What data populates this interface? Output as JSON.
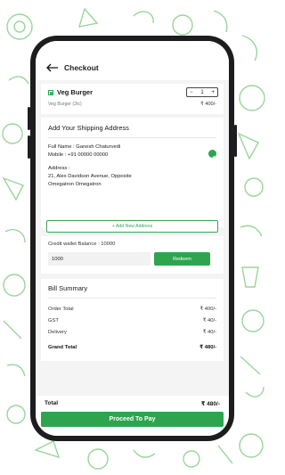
{
  "header": {
    "title": "Checkout"
  },
  "product": {
    "name": "Veg Burger",
    "subtitle": "Veg Burger (2tc)",
    "quantity": "1",
    "decrement": "−",
    "increment": "+",
    "price": "₹ 400/-"
  },
  "shipping": {
    "title": "Add Your Shipping Address",
    "name_label": "Full Name :",
    "name_value": "Ganesh Chaturvedi",
    "mobile_label": "Mobile :",
    "mobile_value": "+91 00000 00000",
    "address_label": "Address :",
    "address_line1": "21, Alex Davidson Avenue, Opposite",
    "address_line2": "Omegatron Omegatron",
    "add_new": "+ Add New Address"
  },
  "credit": {
    "label": "Credit wallet Balance : 10000",
    "input_value": "1000",
    "redeem_label": "Redeem"
  },
  "bill": {
    "title": "Bill Summary",
    "rows": [
      {
        "label": "Order Total",
        "value": "₹ 400/-"
      },
      {
        "label": "GST",
        "value": "₹ 40/-"
      },
      {
        "label": "Delivery",
        "value": "₹ 40/-"
      }
    ],
    "grand_total_label": "Grand Total",
    "grand_total_value": "₹ 480/-"
  },
  "footer": {
    "total_label": "Total",
    "total_value": "₹ 480/-",
    "pay_label": "Proceed To Pay"
  },
  "colors": {
    "accent": "#2ea44f",
    "doodle": "#8fd08f",
    "frame": "#1d1d1f"
  }
}
